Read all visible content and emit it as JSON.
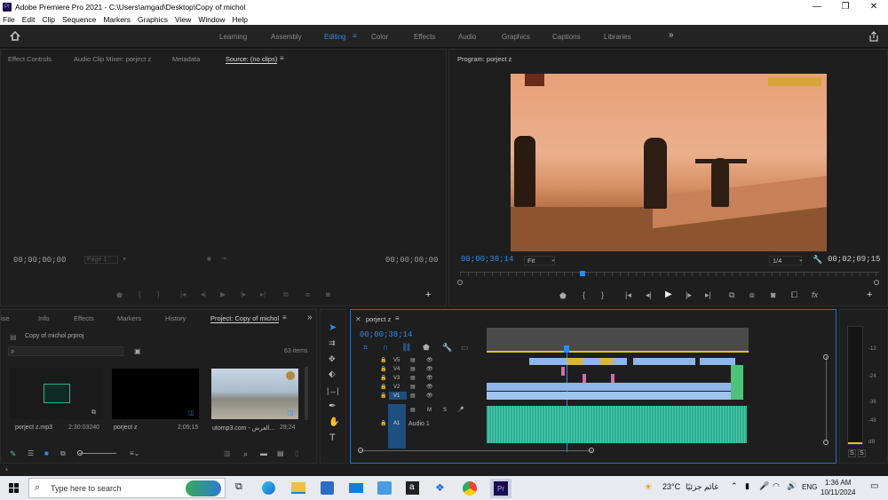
{
  "window": {
    "title": "Adobe Premiere Pro 2021 - C:\\Users\\amgad\\Desktop\\Copy of michol",
    "app_icon": "Pr",
    "controls": [
      "—",
      "❐",
      "✕"
    ]
  },
  "menu": [
    "File",
    "Edit",
    "Clip",
    "Sequence",
    "Markers",
    "Graphics",
    "View",
    "Window",
    "Help"
  ],
  "workspaces": [
    "Learning",
    "Assembly",
    "Editing",
    "Color",
    "Effects",
    "Audio",
    "Graphics",
    "Captions",
    "Libraries"
  ],
  "workspace_overflow": "»",
  "source_panel": {
    "tabs": [
      "Effect Controls",
      "Audio Clip Mixer: porject z",
      "Metadata",
      "Source: (no clips)"
    ],
    "tc_left": "00;00;00;00",
    "page_label": "Page 1",
    "tc_right": "00;00;00;00"
  },
  "program_panel": {
    "title": "Program: porject z",
    "tc_current": "00;00;38;14",
    "fit": "Fit",
    "resolution": "1/4",
    "tc_duration": "00;02;09;15"
  },
  "project_panel": {
    "tabs": [
      "ise",
      "Info",
      "Effects",
      "Markers",
      "History",
      "Project: Copy of michol"
    ],
    "project_file": "Copy of michol.prproj",
    "items_count": "63 items",
    "thumbnails": [
      {
        "name": "porject z.mp3",
        "duration": "2:30:03240"
      },
      {
        "name": "porject z",
        "duration": "2;09;15"
      },
      {
        "name": "utomp3.com - العرش...",
        "duration": "28;24"
      }
    ]
  },
  "timeline": {
    "tab": "porject z",
    "timecode": "00;00;38;14",
    "video_tracks": [
      "V5",
      "V4",
      "V3",
      "V2",
      "V1"
    ],
    "audio_track": {
      "id": "A1",
      "name": "Audio 1",
      "controls": [
        "M",
        "S"
      ]
    }
  },
  "meter": {
    "scale": [
      "-12",
      "-24",
      "-36",
      "-48",
      "dB"
    ],
    "solo": [
      "S",
      "S"
    ]
  },
  "taskbar": {
    "search_placeholder": "Type here to search",
    "weather": "23°C",
    "weather_desc": "غائم جزئيًا",
    "lang": "ENG",
    "time": "1:36 AM",
    "date": "10/11/2024"
  },
  "colors": {
    "accent": "#2d8ceb",
    "video_clip": "#8fb6e8",
    "audio_clip": "#2fae93",
    "green_clip": "#4fc27a"
  }
}
